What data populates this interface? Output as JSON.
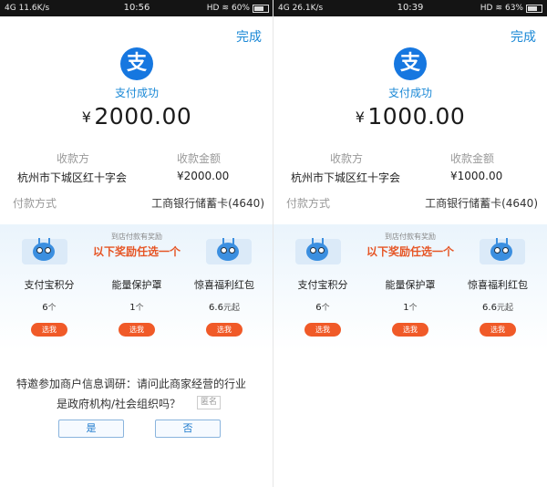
{
  "screens": [
    {
      "status": {
        "network": "4G",
        "speed": "11.6K/s",
        "time": "10:56",
        "hd": "HD",
        "battery": "60%",
        "battery_level": 0.6
      },
      "done_label": "完成",
      "logo_glyph": "支",
      "success_text": "支付成功",
      "amount": {
        "currency": "¥",
        "value": "2000.00"
      },
      "payee_label": "收款方",
      "amount_label": "收款金额",
      "payee": "杭州市下城区红十字会",
      "payee_amount": "¥2000.00",
      "method_label": "付款方式",
      "method": "工商银行储蓄卡(4640)",
      "reward_sub": "到店付款有奖励",
      "reward_head": "以下奖励任选一个",
      "options": [
        {
          "name": "支付宝积分",
          "qty": "6",
          "unit": "个",
          "button": "选我"
        },
        {
          "name": "能量保护罩",
          "qty": "1",
          "unit": "个",
          "button": "选我"
        },
        {
          "name": "惊喜福利红包",
          "qty": "6.6",
          "unit": "元起",
          "button": "选我"
        }
      ],
      "survey": {
        "line1": "特邀参加商户信息调研：请问此商家经营的行业",
        "line2": "是政府机构/社会组织吗？",
        "anonymous": "匿名",
        "yes": "是",
        "no": "否"
      }
    },
    {
      "status": {
        "network": "4G",
        "speed": "26.1K/s",
        "time": "10:39",
        "hd": "HD",
        "battery": "63%",
        "battery_level": 0.63
      },
      "done_label": "完成",
      "logo_glyph": "支",
      "success_text": "支付成功",
      "amount": {
        "currency": "¥",
        "value": "1000.00"
      },
      "payee_label": "收款方",
      "amount_label": "收款金额",
      "payee": "杭州市下城区红十字会",
      "payee_amount": "¥1000.00",
      "method_label": "付款方式",
      "method": "工商银行储蓄卡(4640)",
      "reward_sub": "到店付款有奖励",
      "reward_head": "以下奖励任选一个",
      "options": [
        {
          "name": "支付宝积分",
          "qty": "6",
          "unit": "个",
          "button": "选我"
        },
        {
          "name": "能量保护罩",
          "qty": "1",
          "unit": "个",
          "button": "选我"
        },
        {
          "name": "惊喜福利红包",
          "qty": "6.6",
          "unit": "元起",
          "button": "选我"
        }
      ]
    }
  ],
  "colors": {
    "accent": "#1a88d6",
    "logo": "#1677e0",
    "reward_text": "#e65525",
    "pick_button": "#f05a28"
  }
}
